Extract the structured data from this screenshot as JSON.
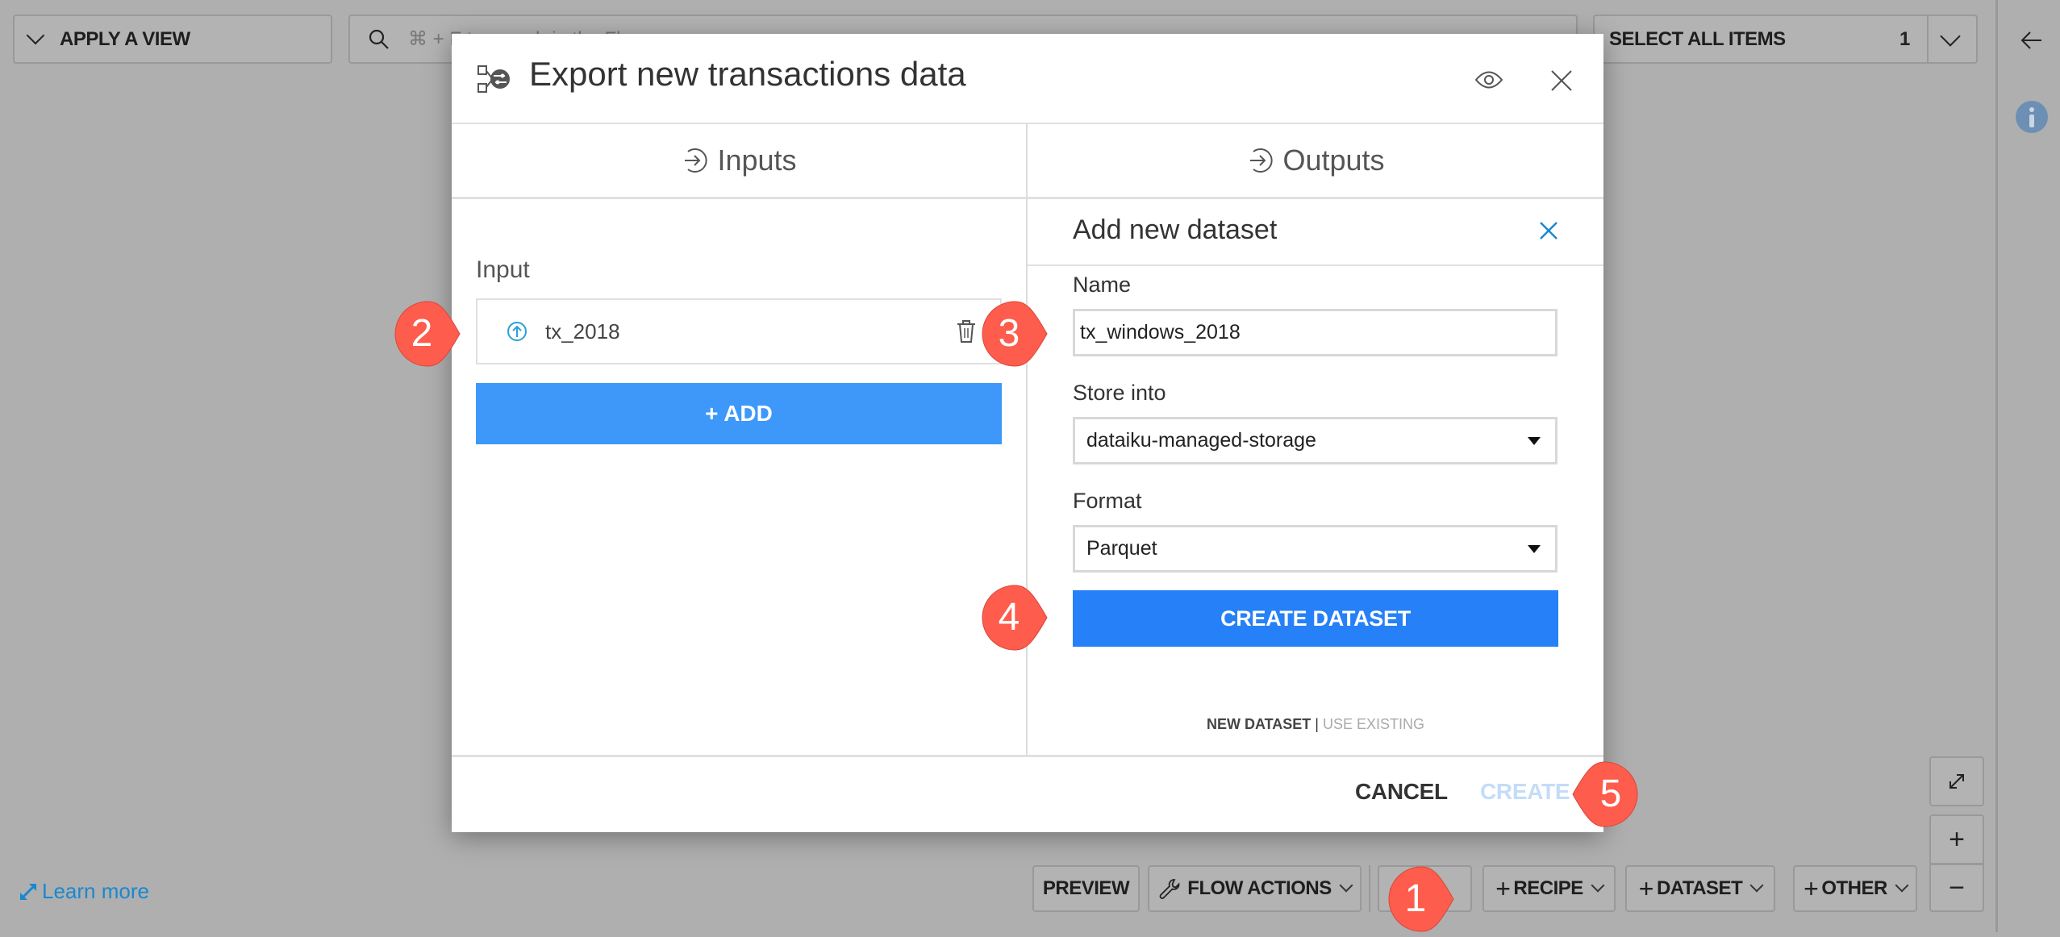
{
  "topbar": {
    "apply_view_label": "APPLY A VIEW",
    "search_placeholder": "⌘ + F to search in the Flow",
    "select_all_label": "SELECT ALL ITEMS",
    "selected_count": "1"
  },
  "sidebar_right": {
    "back_icon": "arrow-left-icon",
    "info_icon": "info-icon"
  },
  "modal": {
    "title": "Export new transactions data",
    "title_icon": "export-recipe-icon",
    "tabs": {
      "inputs": "Inputs",
      "outputs": "Outputs"
    },
    "inputs": {
      "section_label": "Input",
      "items": [
        {
          "name": "tx_2018",
          "icon": "dataset-upload-icon"
        }
      ],
      "add_label": "+ ADD"
    },
    "outputs": {
      "panel_title": "Add new dataset",
      "name_label": "Name",
      "name_value": "tx_windows_2018",
      "store_label": "Store into",
      "store_value": "dataiku-managed-storage",
      "format_label": "Format",
      "format_value": "Parquet",
      "create_dataset_label": "CREATE DATASET",
      "mode_new": "NEW DATASET",
      "mode_separator": "|",
      "mode_existing": "USE EXISTING"
    },
    "footer": {
      "cancel_label": "CANCEL",
      "create_label": "CREATE"
    }
  },
  "toolbar": {
    "preview_label": "PREVIEW",
    "flow_actions_label": "FLOW ACTIONS",
    "hidden_label": "+",
    "recipe_label": "RECIPE",
    "dataset_label": "DATASET",
    "other_label": "OTHER",
    "plus": "+"
  },
  "zoom_controls": {
    "zoom_in": "+",
    "zoom_out": "−"
  },
  "learn_more_label": "Learn more",
  "callouts": [
    "1",
    "2",
    "3",
    "4",
    "5"
  ],
  "colors": {
    "accent_blue": "#3d98fa",
    "primary_button": "#2680f8",
    "callout_red": "#fe5c4c",
    "link_blue": "#1a88d0",
    "disabled_create": "#c3dcf8"
  }
}
